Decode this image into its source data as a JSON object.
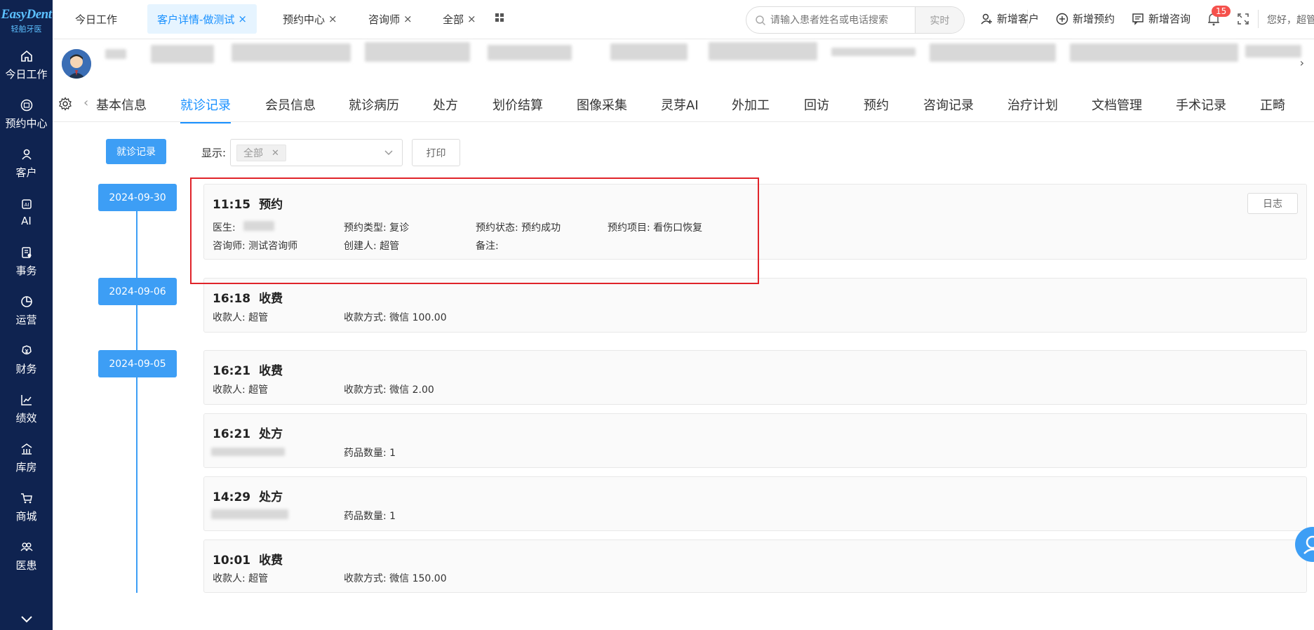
{
  "sidebar": {
    "brand": "EasyDent",
    "brand_sub": "轻舶牙医",
    "items": [
      {
        "label": "今日工作",
        "icon": "home-icon"
      },
      {
        "label": "预约中心",
        "icon": "calendar-circle-icon"
      },
      {
        "label": "客户",
        "icon": "user-icon"
      },
      {
        "label": "AI",
        "icon": "ai-chip-icon"
      },
      {
        "label": "事务",
        "icon": "task-icon"
      },
      {
        "label": "运营",
        "icon": "pie-chart-icon"
      },
      {
        "label": "财务",
        "icon": "finance-icon"
      },
      {
        "label": "绩效",
        "icon": "line-chart-icon"
      },
      {
        "label": "库房",
        "icon": "warehouse-icon"
      },
      {
        "label": "商城",
        "icon": "cart-icon"
      },
      {
        "label": "医患",
        "icon": "people-icon"
      }
    ]
  },
  "tabs": [
    {
      "label": "今日工作",
      "active": false,
      "closable": false
    },
    {
      "label": "客户详情-做测试",
      "active": true,
      "closable": true
    },
    {
      "label": "预约中心",
      "active": false,
      "closable": true
    },
    {
      "label": "咨询师",
      "active": false,
      "closable": true
    },
    {
      "label": "全部",
      "active": false,
      "closable": true
    }
  ],
  "search": {
    "placeholder": "请输入患者姓名或电话搜索",
    "mode": "实时"
  },
  "actions": {
    "new_customer": "新增客户",
    "new_appointment": "新增预约",
    "new_consult": "新增咨询"
  },
  "notifications": {
    "count": "15"
  },
  "greeting": "您好，超管",
  "subtabs": [
    "基本信息",
    "就诊记录",
    "会员信息",
    "就诊病历",
    "处方",
    "划价结算",
    "图像采集",
    "灵芽AI",
    "外加工",
    "回访",
    "预约",
    "咨询记录",
    "治疗计划",
    "文档管理",
    "手术记录",
    "正畸"
  ],
  "active_subtab": "就诊记录",
  "filter": {
    "record_button": "就诊记录",
    "show_label": "显示:",
    "selected_tag": "全部",
    "print_button": "打印"
  },
  "timeline": {
    "dates": [
      "2024-09-30",
      "2024-09-06",
      "2024-09-05"
    ],
    "records": [
      {
        "time": "11:15",
        "kind": "预约",
        "doctor_label": "医生:",
        "type_label": "预约类型:",
        "type_value": "复诊",
        "status_label": "预约状态:",
        "status_value": "预约成功",
        "item_label": "预约项目:",
        "item_value": "看伤口恢复",
        "consultant_label": "咨询师:",
        "consultant_value": "测试咨询师",
        "creator_label": "创建人:",
        "creator_value": "超管",
        "note_label": "备注:",
        "log_button": "日志"
      },
      {
        "time": "16:18",
        "kind": "收费",
        "payee_label": "收款人:",
        "payee_value": "超管",
        "method_label": "收款方式:",
        "method_value": "微信 100.00"
      },
      {
        "time": "16:21",
        "kind": "收费",
        "payee_label": "收款人:",
        "payee_value": "超管",
        "method_label": "收款方式:",
        "method_value": "微信 2.00"
      },
      {
        "time": "16:21",
        "kind": "处方",
        "qty_label": "药品数量:",
        "qty_value": "1"
      },
      {
        "time": "14:29",
        "kind": "处方",
        "qty_label": "药品数量:",
        "qty_value": "1"
      },
      {
        "time": "10:01",
        "kind": "收费",
        "payee_label": "收款人:",
        "payee_value": "超管",
        "method_label": "收款方式:",
        "method_value": "微信 150.00"
      }
    ]
  },
  "colors": {
    "primary": "#3d9ef5",
    "sidebar": "#0f2350",
    "highlight": "#e0242a",
    "badge": "#f5514c"
  }
}
